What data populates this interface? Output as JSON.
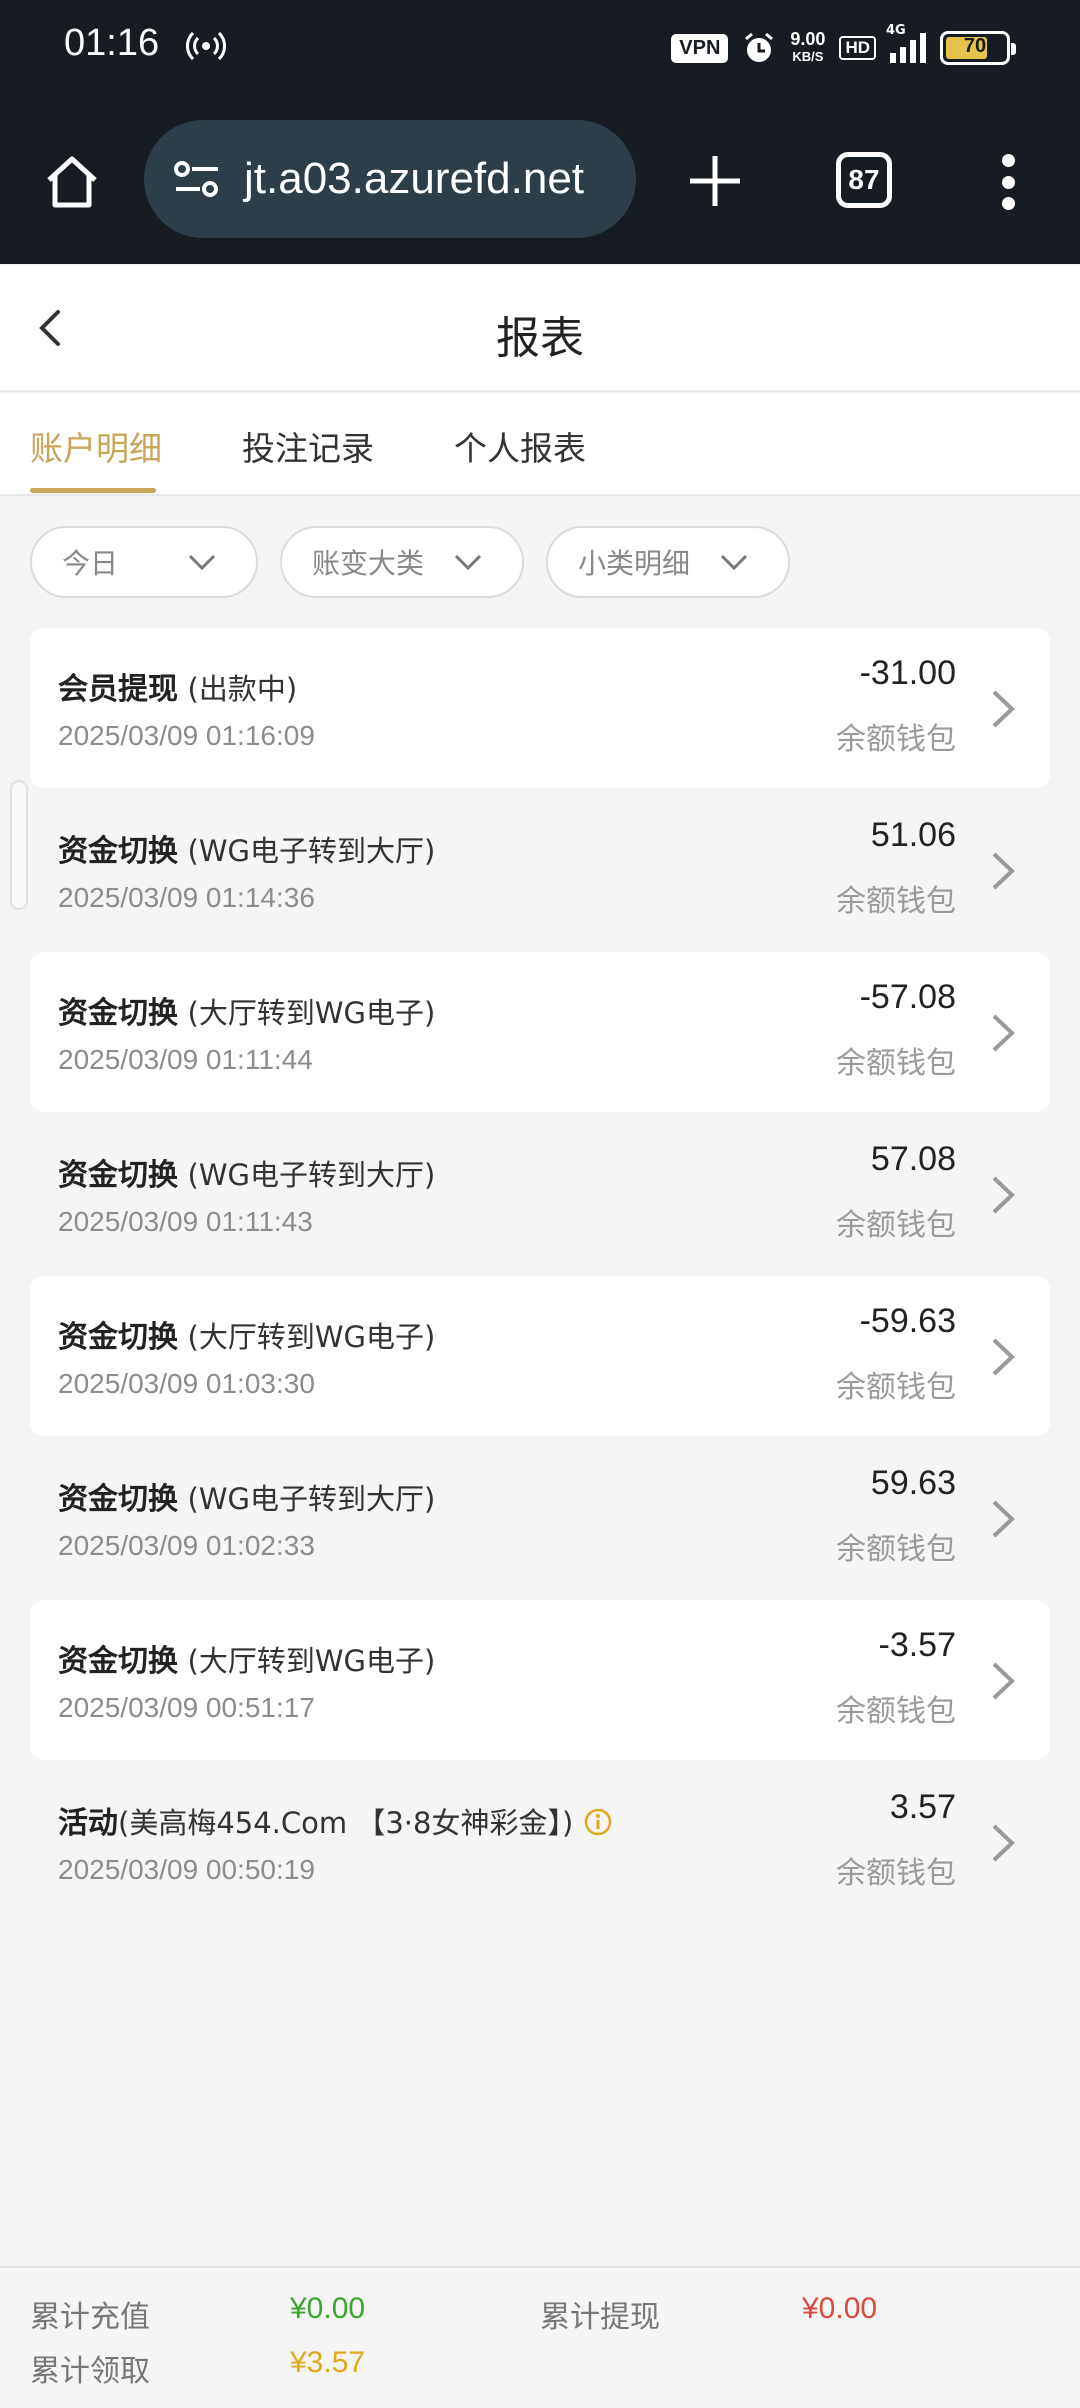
{
  "status_bar": {
    "time": "01:16",
    "vpn": "VPN",
    "speed_value": "9.00",
    "speed_unit": "KB/S",
    "hd": "HD",
    "network": "4G",
    "battery": "70"
  },
  "browser": {
    "url": "jt.a03.azurefd.net",
    "tab_count": "87"
  },
  "header": {
    "title": "报表"
  },
  "tabs": [
    {
      "label": "账户明细",
      "active": true
    },
    {
      "label": "投注记录",
      "active": false
    },
    {
      "label": "个人报表",
      "active": false
    }
  ],
  "filters": [
    {
      "label": "今日"
    },
    {
      "label": "账变大类"
    },
    {
      "label": "小类明细"
    }
  ],
  "records": [
    {
      "title": "会员提现",
      "detail": "(出款中)",
      "time": "2025/03/09 01:16:09",
      "amount": "-31.00",
      "wallet": "余额钱包"
    },
    {
      "title": "资金切换",
      "detail": "(WG电子转到大厅)",
      "time": "2025/03/09 01:14:36",
      "amount": "51.06",
      "wallet": "余额钱包"
    },
    {
      "title": "资金切换",
      "detail": "(大厅转到WG电子)",
      "time": "2025/03/09 01:11:44",
      "amount": "-57.08",
      "wallet": "余额钱包"
    },
    {
      "title": "资金切换",
      "detail": "(WG电子转到大厅)",
      "time": "2025/03/09 01:11:43",
      "amount": "57.08",
      "wallet": "余额钱包"
    },
    {
      "title": "资金切换",
      "detail": "(大厅转到WG电子)",
      "time": "2025/03/09 01:03:30",
      "amount": "-59.63",
      "wallet": "余额钱包"
    },
    {
      "title": "资金切换",
      "detail": "(WG电子转到大厅)",
      "time": "2025/03/09 01:02:33",
      "amount": "59.63",
      "wallet": "余额钱包"
    },
    {
      "title": "资金切换",
      "detail": "(大厅转到WG电子)",
      "time": "2025/03/09 00:51:17",
      "amount": "-3.57",
      "wallet": "余额钱包"
    },
    {
      "title": "活动",
      "detail": "(美高梅454.Com 【3·8女神彩金】)",
      "time": "2025/03/09 00:50:19",
      "amount": "3.57",
      "wallet": "余额钱包"
    }
  ],
  "footer": {
    "total_deposit_label": "累计充值",
    "total_deposit_value": "¥0.00",
    "total_withdraw_label": "累计提现",
    "total_withdraw_value": "¥0.00",
    "total_claim_label": "累计领取",
    "total_claim_value": "¥3.57"
  },
  "colors": {
    "accent": "#c9a55a",
    "positive": "#3aa62c",
    "negative": "#d9493d",
    "claim": "#e0a819"
  }
}
